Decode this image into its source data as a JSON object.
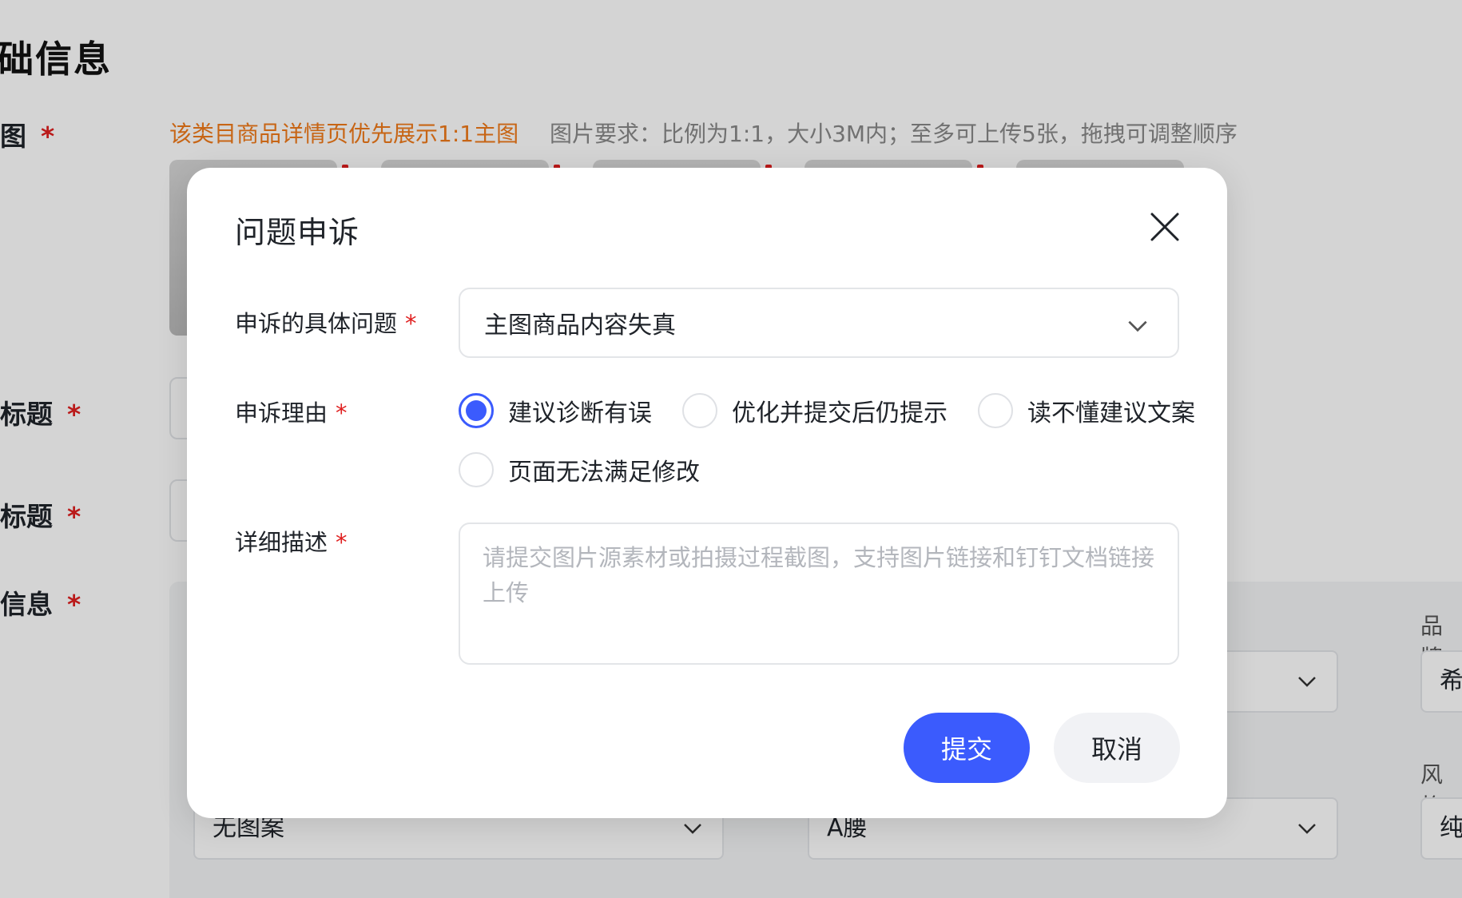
{
  "background": {
    "section_title": "础信息",
    "labels": {
      "main_image": "图",
      "title_1": "标题",
      "title_2": "标题",
      "info": "信息",
      "required_mark": "*"
    },
    "main_image_hint": "该类目商品详情页优先展示1:1主图",
    "image_requirements": "图片要求：比例为1:1，大小3M内；至多可上传5张，拖拽可调整顺序",
    "selects": {
      "pattern": "无图案",
      "waist": "A腰"
    },
    "side_labels": {
      "brand": "品牌",
      "brand_value": "希",
      "style": "风格",
      "style_value": "纯"
    }
  },
  "modal": {
    "title": "问题申诉",
    "fields": {
      "issue": {
        "label": "申诉的具体问题",
        "required_mark": "*",
        "value": "主图商品内容失真"
      },
      "reason": {
        "label": "申诉理由",
        "required_mark": "*",
        "options": [
          {
            "label": "建议诊断有误",
            "checked": true
          },
          {
            "label": "优化并提交后仍提示",
            "checked": false
          },
          {
            "label": "读不懂建议文案",
            "checked": false
          },
          {
            "label": "页面无法满足修改",
            "checked": false
          }
        ]
      },
      "description": {
        "label": "详细描述",
        "required_mark": "*",
        "placeholder": "请提交图片源素材或拍摄过程截图，支持图片链接和钉钉文档链接上传"
      }
    },
    "buttons": {
      "submit": "提交",
      "cancel": "取消"
    }
  },
  "colors": {
    "primary": "#3b5bfd",
    "required": "#e02020",
    "hint_orange": "#f07a1a"
  }
}
